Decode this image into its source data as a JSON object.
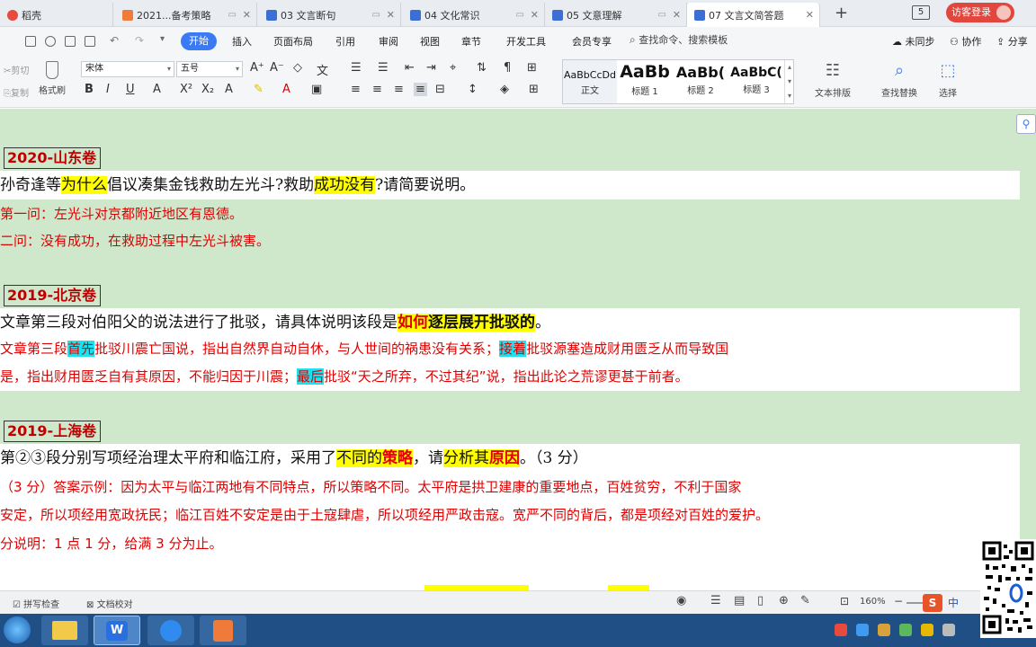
{
  "tabs": [
    {
      "label": "稻壳",
      "color": "#e84a3d"
    },
    {
      "label": "2021...备考策略",
      "color": "#f07a3a"
    },
    {
      "label": "03 文言断句",
      "color": "#3b6fd6"
    },
    {
      "label": "04 文化常识",
      "color": "#3b6fd6"
    },
    {
      "label": "05 文意理解",
      "color": "#3b6fd6"
    },
    {
      "label": "07 文言文简答题",
      "color": "#3b6fd6"
    }
  ],
  "tab_new": "+",
  "login_label": "访客登录",
  "page_badge": "5",
  "menu": {
    "items": [
      "开始",
      "插入",
      "页面布局",
      "引用",
      "审阅",
      "视图",
      "章节",
      "开发工具",
      "会员专享"
    ],
    "search_placeholder": "查找命令、搜索模板",
    "right": [
      "未同步",
      "协作",
      "分享"
    ]
  },
  "ribbon": {
    "cut": "剪切",
    "copy": "复制",
    "format_painter": "格式刷",
    "font_name": "宋体",
    "font_size": "五号",
    "styles": [
      {
        "sample": "AaBbCcDd",
        "name": "正文"
      },
      {
        "sample": "AaBb",
        "name": "标题 1"
      },
      {
        "sample": "AaBb(",
        "name": "标题 2"
      },
      {
        "sample": "AaBbC(",
        "name": "标题 3"
      }
    ],
    "text_layout": "文本排版",
    "find_replace": "查找替换",
    "select": "选择"
  },
  "doc": {
    "s1": {
      "header": "2020-山东卷",
      "q": [
        "孙奇逢等",
        "为什么",
        "倡议凑集金钱救助左光斗?救助",
        "成功没有",
        "?请简要说明。"
      ],
      "a1": "第一问：左光斗对京都附近地区有恩德。",
      "a2": "二问：没有成功，在救助过程中左光斗被害。"
    },
    "s2": {
      "header": "2019-北京卷",
      "q": [
        " 文章第三段对伯阳父的说法进行了批驳，请具体说明该段是",
        "如何",
        "逐层展开批驳的",
        "。"
      ],
      "a1": [
        "文章第三段",
        "首先",
        "批驳川震亡国说，指出自然界自动自休，与人世间的祸患没有关系；",
        "接着",
        "批驳源塞造成财用匮乏从而导致国"
      ],
      "a2": [
        "是，指出财用匮乏自有其原因，不能归因于川震；",
        "最后",
        "批驳“天之所弃，不过其纪”说，指出此论之荒谬更甚于前者。"
      ]
    },
    "s3": {
      "header": "2019-上海卷",
      "q": [
        "第②③段分别写项经治理太平府和临江府，采用了",
        "不同的",
        "策略",
        "，请",
        "分析其",
        "原因",
        "。（3 分）"
      ],
      "a1": "（3 分）答案示例：因为太平与临江两地有不同特点，所以策略不同。太平府是拱卫建康的重要地点，百姓贫穷，不利于国家",
      "a2": "安定，所以项经用宽政抚民；临江百姓不安定是由于土寇肆虐，所以项经用严政击寇。宽严不同的背后，都是项经对百姓的爱护。",
      "a3": "分说明：1 点 1 分，给满 3 分为止。"
    }
  },
  "status": {
    "spell": "拼写检查",
    "proof": "文档校对",
    "zoom": "160%",
    "ime": "中"
  }
}
